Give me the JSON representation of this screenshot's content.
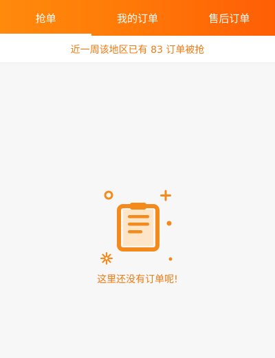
{
  "tabs": [
    {
      "label": "抢单",
      "active": true
    },
    {
      "label": "我的订单",
      "active": false
    },
    {
      "label": "售后订单",
      "active": false
    }
  ],
  "notice": {
    "text": "近一周该地区已有 83 订单被抢"
  },
  "empty_state": {
    "icon": "clipboard-icon",
    "message": "这里还没有订单呢!"
  },
  "colors": {
    "accent": "#ff7a08",
    "accent_dark": "#ff5e05",
    "text_accent": "#f07a12",
    "background": "#f7f7f7"
  }
}
